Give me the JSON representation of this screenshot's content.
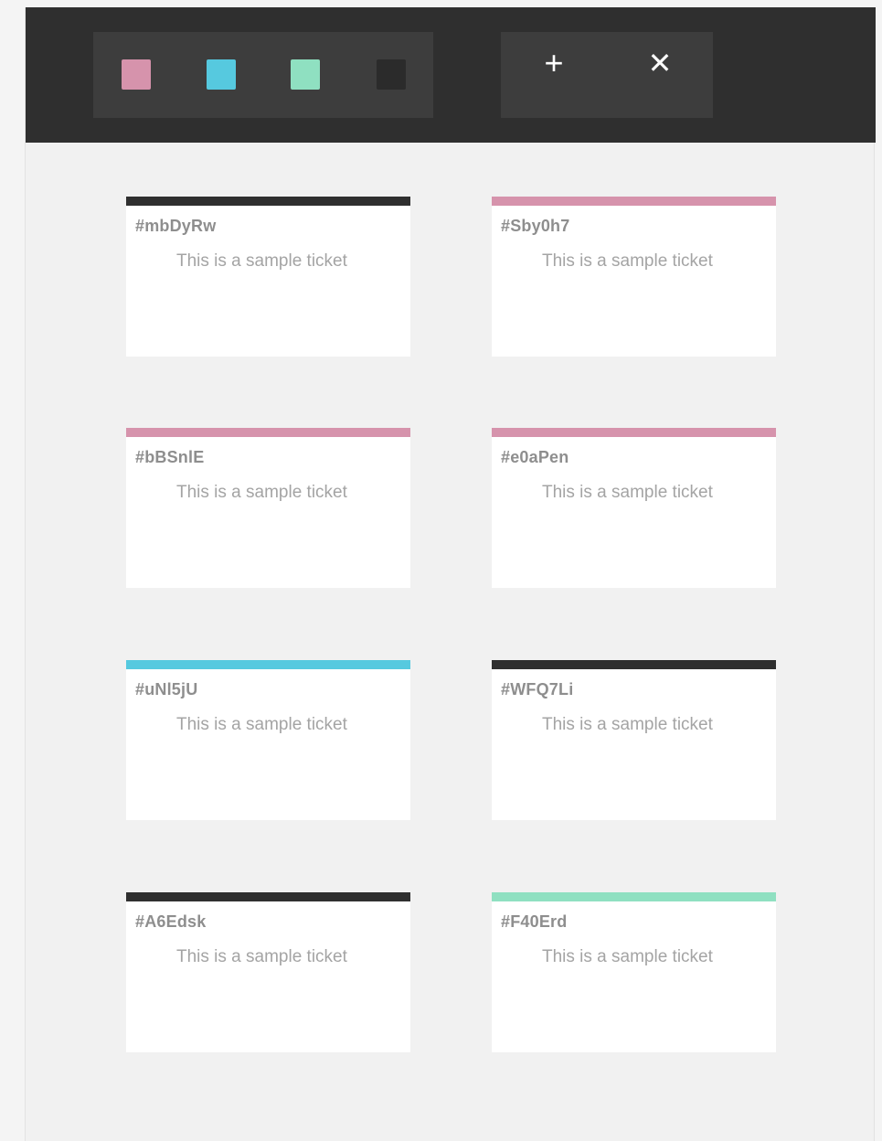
{
  "toolbar": {
    "colors": [
      {
        "name": "pink",
        "hex": "#d693ac"
      },
      {
        "name": "blue",
        "hex": "#56c9df"
      },
      {
        "name": "green",
        "hex": "#8fe0c1"
      },
      {
        "name": "dark",
        "hex": "#2b2b2b"
      }
    ],
    "add_label": "+",
    "close_label": "✕"
  },
  "tickets": [
    {
      "id": "#mbDyRw",
      "text": "This is a sample ticket",
      "color": "#2f2f2f"
    },
    {
      "id": "#Sby0h7",
      "text": "This is a sample ticket",
      "color": "#d693ac"
    },
    {
      "id": "#bBSnlE",
      "text": "This is a sample ticket",
      "color": "#d693ac"
    },
    {
      "id": "#e0aPen",
      "text": "This is a sample ticket",
      "color": "#d693ac"
    },
    {
      "id": "#uNl5jU",
      "text": "This is a sample ticket",
      "color": "#56c9df"
    },
    {
      "id": "#WFQ7Li",
      "text": "This is a sample ticket",
      "color": "#2f2f2f"
    },
    {
      "id": "#A6Edsk",
      "text": "This is a sample ticket",
      "color": "#2f2f2f"
    },
    {
      "id": "#F40Erd",
      "text": "This is a sample ticket",
      "color": "#8fe0c1"
    }
  ]
}
